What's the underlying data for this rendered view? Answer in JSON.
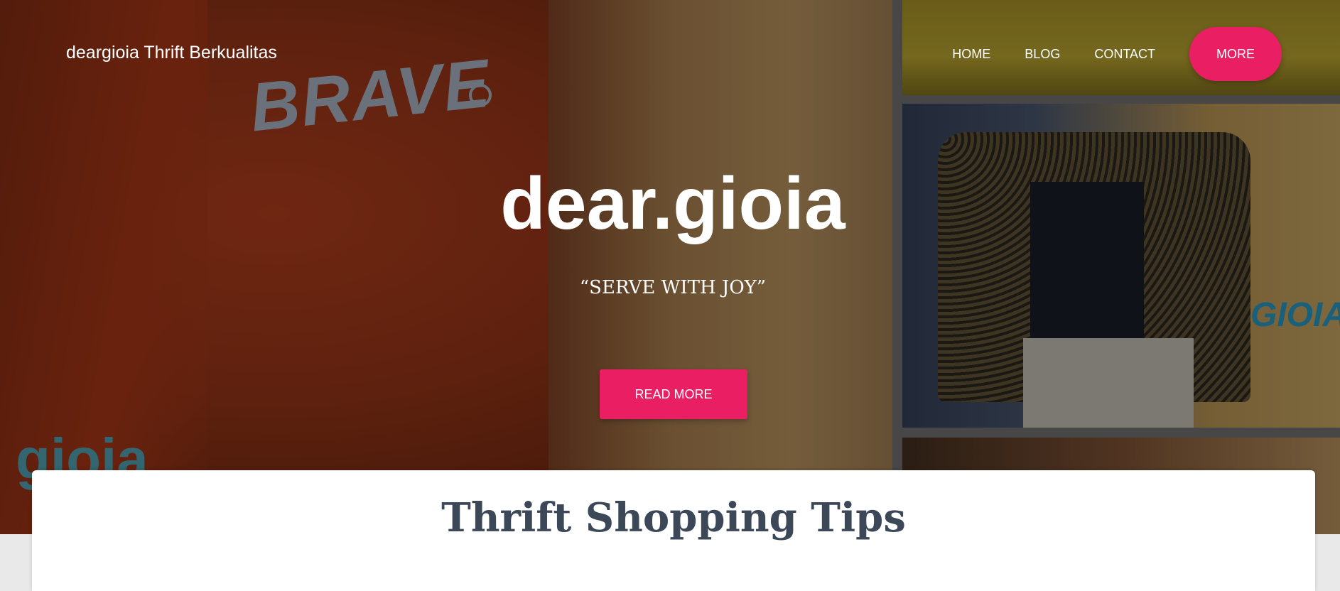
{
  "header": {
    "brand": "deargioia Thrift Berkualitas",
    "nav": {
      "home": "HOME",
      "blog": "BLOG",
      "contact": "CONTACT",
      "more": "MORE"
    }
  },
  "hero": {
    "title": "dear.gioia",
    "tagline": "“SERVE WITH JOY”",
    "cta": "READ MORE",
    "image_text": {
      "shirt_logo": "BRAVE",
      "corner_logo": "gioia",
      "side_logo": "GIOIA"
    }
  },
  "section": {
    "title": "Thrift Shopping Tips"
  },
  "colors": {
    "accent": "#e91e63",
    "heading": "#3c4858"
  }
}
